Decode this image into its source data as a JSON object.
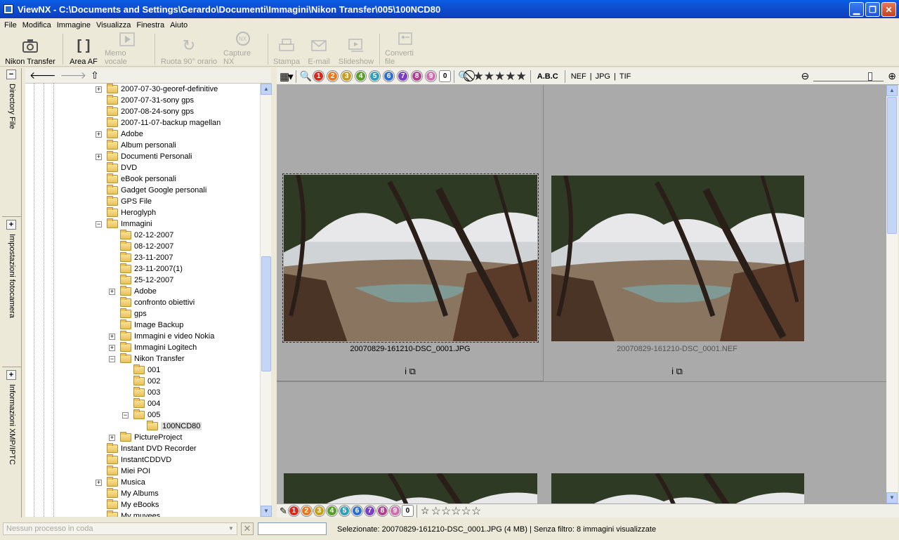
{
  "window": {
    "title": "ViewNX - C:\\Documents and Settings\\Gerardo\\Documenti\\Immagini\\Nikon Transfer\\005\\100NCD80"
  },
  "menu": [
    "File",
    "Modifica",
    "Immagine",
    "Visualizza",
    "Finestra",
    "Aiuto"
  ],
  "toolbar": {
    "nikon_transfer": "Nikon Transfer",
    "area_af": "Area AF",
    "memo_vocale": "Memo vocale",
    "ruota": "Ruota 90° orario",
    "capture_nx": "Capture NX",
    "stampa": "Stampa",
    "email": "E-mail",
    "slideshow": "Slideshow",
    "converti": "Converti file"
  },
  "side_panels": [
    "Directory File",
    "Impostazioni fotocamera",
    "Informazioni XMP/IPTC"
  ],
  "tree": [
    {
      "label": "2007-07-30-georef-definitive",
      "exp": "+"
    },
    {
      "label": "2007-07-31-sony gps",
      "exp": ""
    },
    {
      "label": "2007-08-24-sony gps",
      "exp": ""
    },
    {
      "label": "2007-11-07-backup magellan",
      "exp": ""
    },
    {
      "label": "Adobe",
      "exp": "+"
    },
    {
      "label": "Album personali",
      "exp": ""
    },
    {
      "label": "Documenti Personali",
      "exp": "+"
    },
    {
      "label": "DVD",
      "exp": ""
    },
    {
      "label": "eBook personali",
      "exp": ""
    },
    {
      "label": "Gadget Google personali",
      "exp": ""
    },
    {
      "label": "GPS File",
      "exp": ""
    },
    {
      "label": "Heroglyph",
      "exp": ""
    },
    {
      "label": "Immagini",
      "exp": "−"
    },
    {
      "label": "02-12-2007",
      "exp": ""
    },
    {
      "label": "08-12-2007",
      "exp": ""
    },
    {
      "label": "23-11-2007",
      "exp": ""
    },
    {
      "label": "23-11-2007(1)",
      "exp": ""
    },
    {
      "label": "25-12-2007",
      "exp": ""
    },
    {
      "label": "Adobe",
      "exp": "+"
    },
    {
      "label": "confronto obiettivi",
      "exp": ""
    },
    {
      "label": "gps",
      "exp": ""
    },
    {
      "label": "Image Backup",
      "exp": ""
    },
    {
      "label": "Immagini e video Nokia",
      "exp": "+"
    },
    {
      "label": "Immagini Logitech",
      "exp": "+"
    },
    {
      "label": "Nikon Transfer",
      "exp": "−"
    },
    {
      "label": "001",
      "exp": ""
    },
    {
      "label": "002",
      "exp": ""
    },
    {
      "label": "003",
      "exp": ""
    },
    {
      "label": "004",
      "exp": ""
    },
    {
      "label": "005",
      "exp": "−"
    },
    {
      "label": "100NCD80",
      "exp": "",
      "selected": true
    },
    {
      "label": "PictureProject",
      "exp": "+"
    },
    {
      "label": "Instant DVD Recorder",
      "exp": ""
    },
    {
      "label": "InstantCDDVD",
      "exp": ""
    },
    {
      "label": "Miei POI",
      "exp": ""
    },
    {
      "label": "Musica",
      "exp": "+"
    },
    {
      "label": "My Albums",
      "exp": ""
    },
    {
      "label": "My eBooks",
      "exp": ""
    },
    {
      "label": "My muvees",
      "exp": ""
    }
  ],
  "filter": {
    "labels": [
      "1",
      "2",
      "3",
      "4",
      "5",
      "6",
      "7",
      "8",
      "9",
      "0"
    ],
    "label_colors": [
      "#d9281d",
      "#e8791e",
      "#c7a01b",
      "#5a9e2a",
      "#2fa0b8",
      "#2e6ed1",
      "#7b3fc1",
      "#b0408f",
      "#cf6fb0",
      "#ffffff"
    ],
    "abc": "A.B.C",
    "formats": [
      "NEF",
      "JPG",
      "TIF"
    ]
  },
  "thumbnails": [
    {
      "name": "20070829-161210-DSC_0001.JPG",
      "selected": true,
      "icons": "i ⧉"
    },
    {
      "name": "20070829-161210-DSC_0001.NEF",
      "selected": false,
      "icons": "i ⧉"
    }
  ],
  "status": {
    "queue_placeholder": "Nessun processo in coda",
    "info": "Selezionate: 20070829-161210-DSC_0001.JPG (4 MB) | Senza filtro: 8 immagini visualizzate"
  }
}
